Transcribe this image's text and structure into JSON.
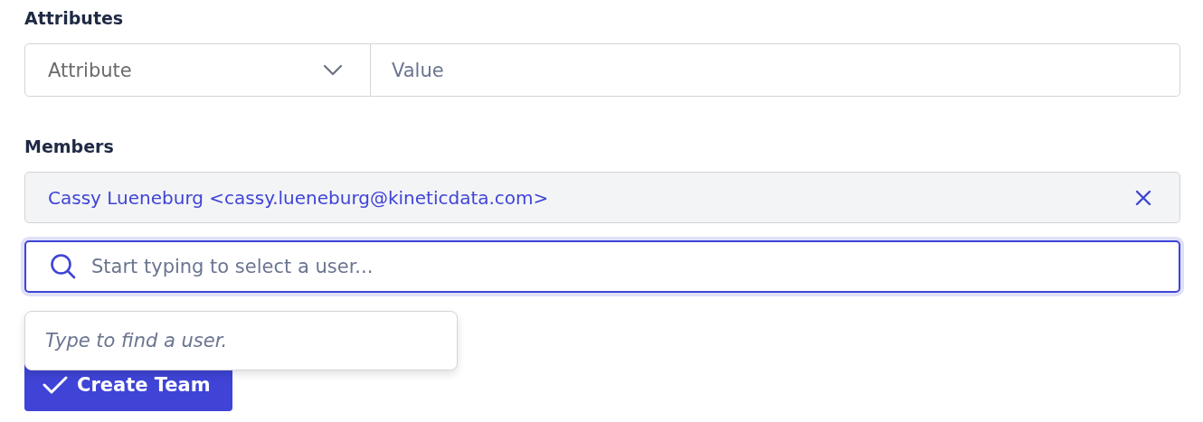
{
  "attributes": {
    "label": "Attributes",
    "attribute_select": {
      "placeholder": "Attribute"
    },
    "value_field": {
      "placeholder": "Value"
    }
  },
  "members": {
    "label": "Members",
    "selected_members": [
      {
        "text": "Cassy Lueneburg <cassy.lueneburg@kineticdata.com>"
      }
    ],
    "search_field": {
      "placeholder": "Start typing to select a user...",
      "focused": true
    },
    "dropdown": {
      "message": "Type to find a user."
    }
  },
  "submit_button": {
    "label": "Create Team"
  }
}
